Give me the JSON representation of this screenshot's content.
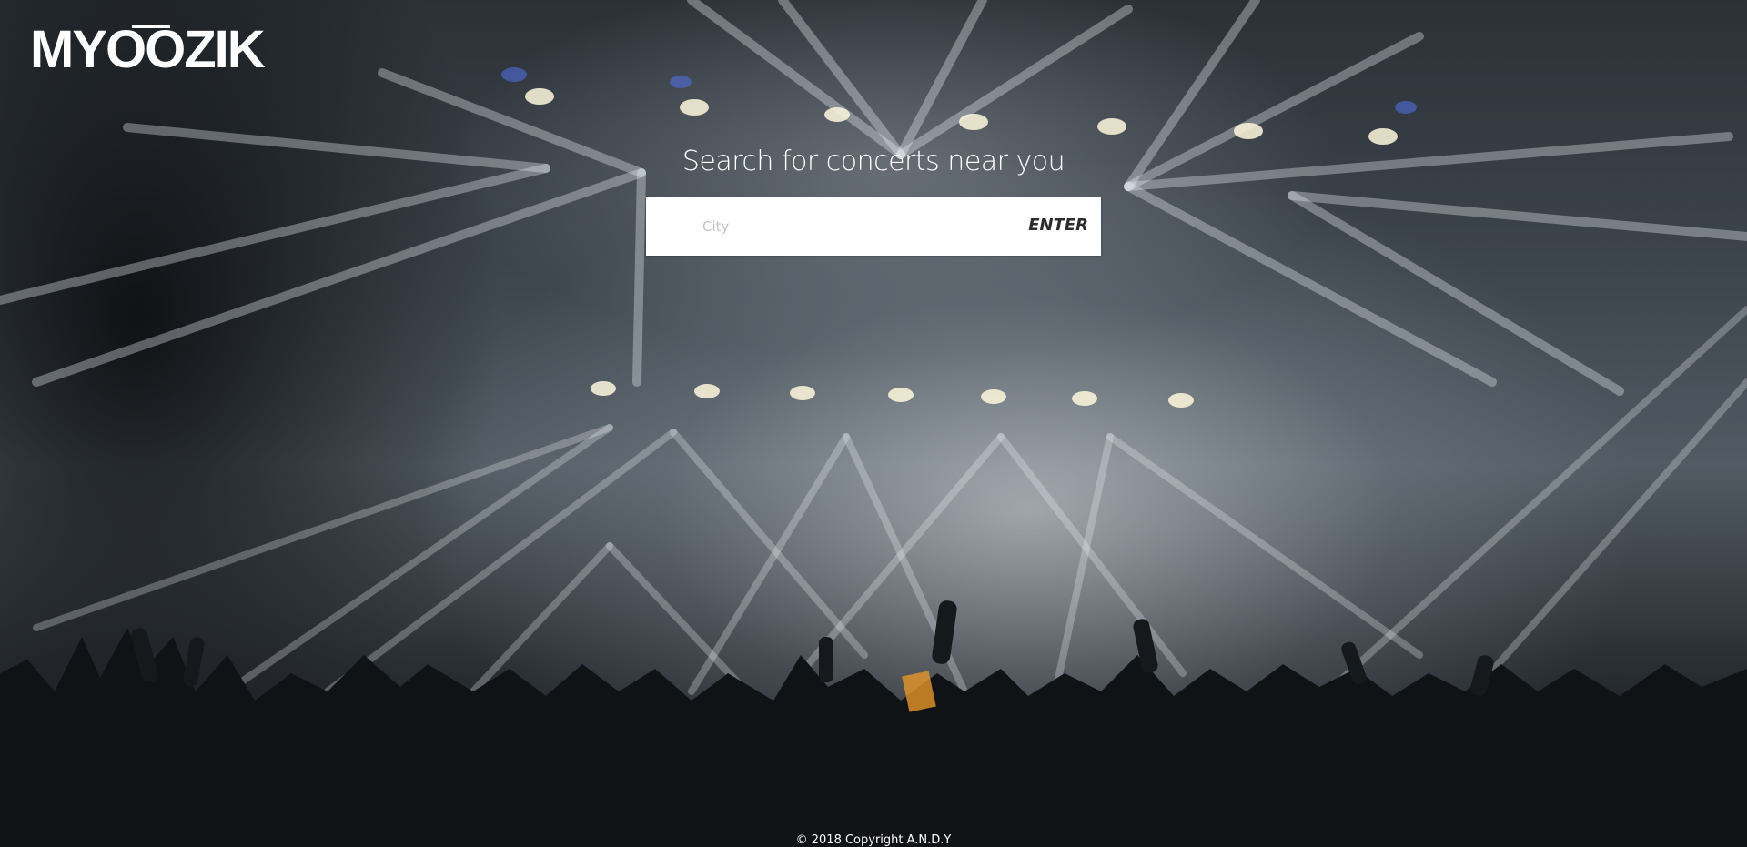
{
  "brand": {
    "logo_text": "MYOOZIK"
  },
  "hero": {
    "headline": "Search for concerts near you",
    "background": "concert-crowd-stage-lights-photo"
  },
  "search": {
    "placeholder": "City",
    "value": "",
    "submit_label": "ENTER"
  },
  "footer": {
    "copyright": "© 2018 Copyright A.N.D.Y"
  },
  "colors": {
    "text_light": "#ffffff",
    "search_bg": "#ffffff",
    "button_text": "#2c2c2c",
    "placeholder": "#c4c4c4"
  }
}
